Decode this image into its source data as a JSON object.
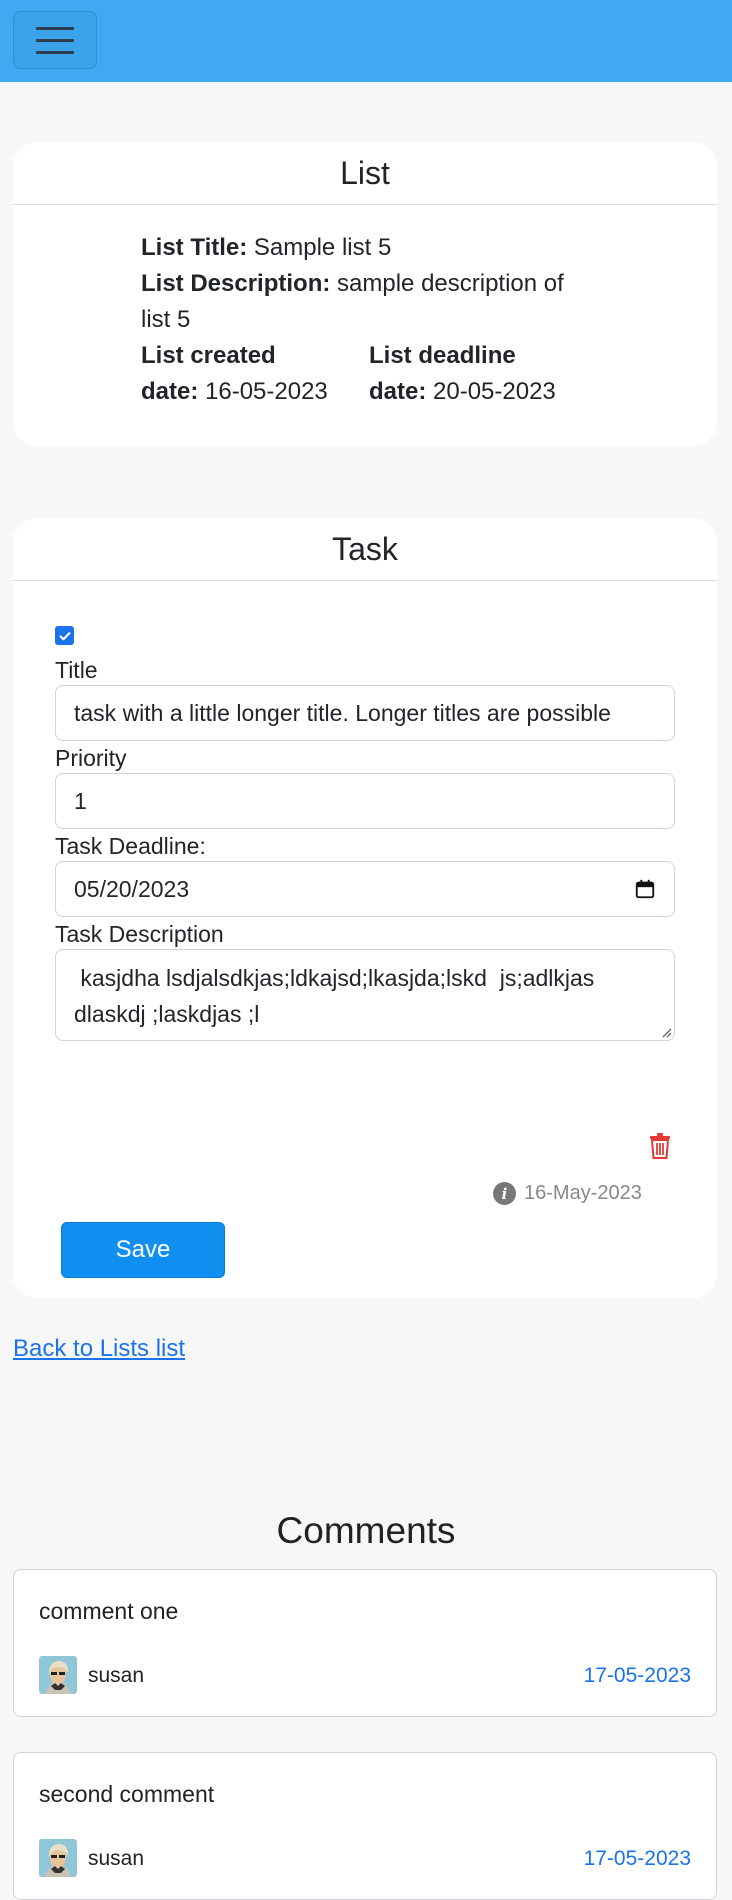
{
  "navbar": {
    "menu_icon": "hamburger-icon"
  },
  "list_card": {
    "header": "List",
    "title_label": "List Title:",
    "title_value": "Sample list 5",
    "description_label": "List Description:",
    "description_value": "sample description of list 5",
    "created_label_1": "List created",
    "created_label_2": "date:",
    "created_value": "16-05-2023",
    "deadline_label_1": "List deadline",
    "deadline_label_2": "date:",
    "deadline_value": "20-05-2023"
  },
  "task_card": {
    "header": "Task",
    "completed_checked": true,
    "title_label": "Title",
    "title_value": "task with a little longer title. Longer titles are possible",
    "priority_label": "Priority",
    "priority_value": "1",
    "deadline_label": "Task Deadline:",
    "deadline_value": "05/20/2023",
    "description_label": "Task Description",
    "description_value": " kasjdha lsdjalsdkjas;ldkajsd;lkasjda;lskd  js;adlkjas dlaskdj ;laskdjas ;l",
    "created_date": "16-May-2023",
    "save_label": "Save",
    "delete_icon": "trash-icon",
    "info_icon": "info-icon",
    "colors": {
      "delete": "#e53935",
      "save": "#118ff0"
    }
  },
  "back_link": "Back to Lists list",
  "comments": {
    "title": "Comments",
    "items": [
      {
        "text": "comment one",
        "author": "susan",
        "date": "17-05-2023"
      },
      {
        "text": "second comment",
        "author": "susan",
        "date": "17-05-2023"
      }
    ]
  }
}
